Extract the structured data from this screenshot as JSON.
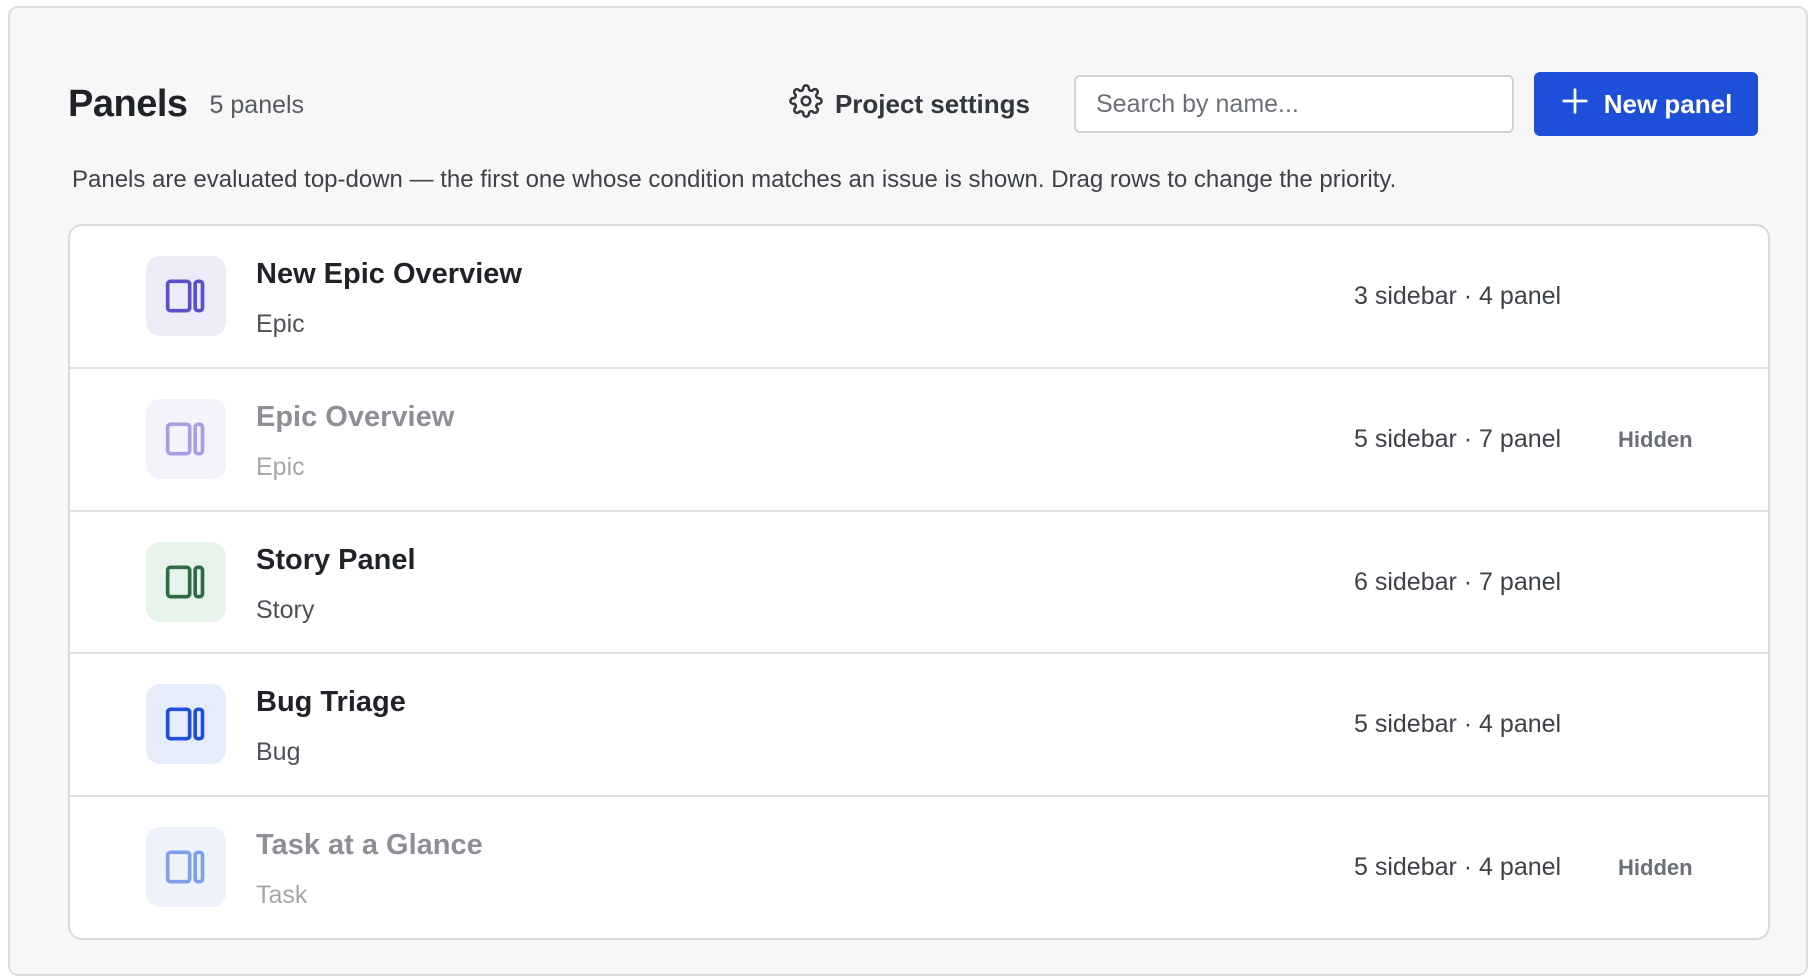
{
  "header": {
    "title": "Panels",
    "count": "5 panels",
    "settings_label": "Project settings",
    "settings_icon": "gear-icon",
    "search_placeholder": "Search by name...",
    "new_button_label": "New panel",
    "new_button_icon": "plus-icon",
    "accent_color": "#1d4fd8"
  },
  "hint": "Panels are evaluated top-down — the first one whose condition matches an issue is shown. Drag rows to change the priority.",
  "panels": [
    {
      "name": "New Epic Overview",
      "type": "Epic",
      "counts": "3 sidebar · 4 panel",
      "status": "",
      "hidden": false,
      "icon": "panel-layout-icon",
      "icon_color": "#5b4fc7",
      "icon_bg": "#edebf8"
    },
    {
      "name": "Epic Overview",
      "type": "Epic",
      "counts": "5 sidebar · 7 panel",
      "status": "Hidden",
      "hidden": true,
      "icon": "panel-layout-icon",
      "icon_color": "#a79ee3",
      "icon_bg": "#f4f3fb"
    },
    {
      "name": "Story Panel",
      "type": "Story",
      "counts": "6 sidebar · 7 panel",
      "status": "",
      "hidden": false,
      "icon": "panel-layout-icon",
      "icon_color": "#2f6b45",
      "icon_bg": "#e8f3ec"
    },
    {
      "name": "Bug Triage",
      "type": "Bug",
      "counts": "5 sidebar · 4 panel",
      "status": "",
      "hidden": false,
      "icon": "panel-layout-icon",
      "icon_color": "#1d4fd8",
      "icon_bg": "#e6ecfa"
    },
    {
      "name": "Task at a Glance",
      "type": "Task",
      "counts": "5 sidebar · 4 panel",
      "status": "Hidden",
      "hidden": true,
      "icon": "panel-layout-icon",
      "icon_color": "#7f9fe6",
      "icon_bg": "#eef2fb"
    }
  ]
}
